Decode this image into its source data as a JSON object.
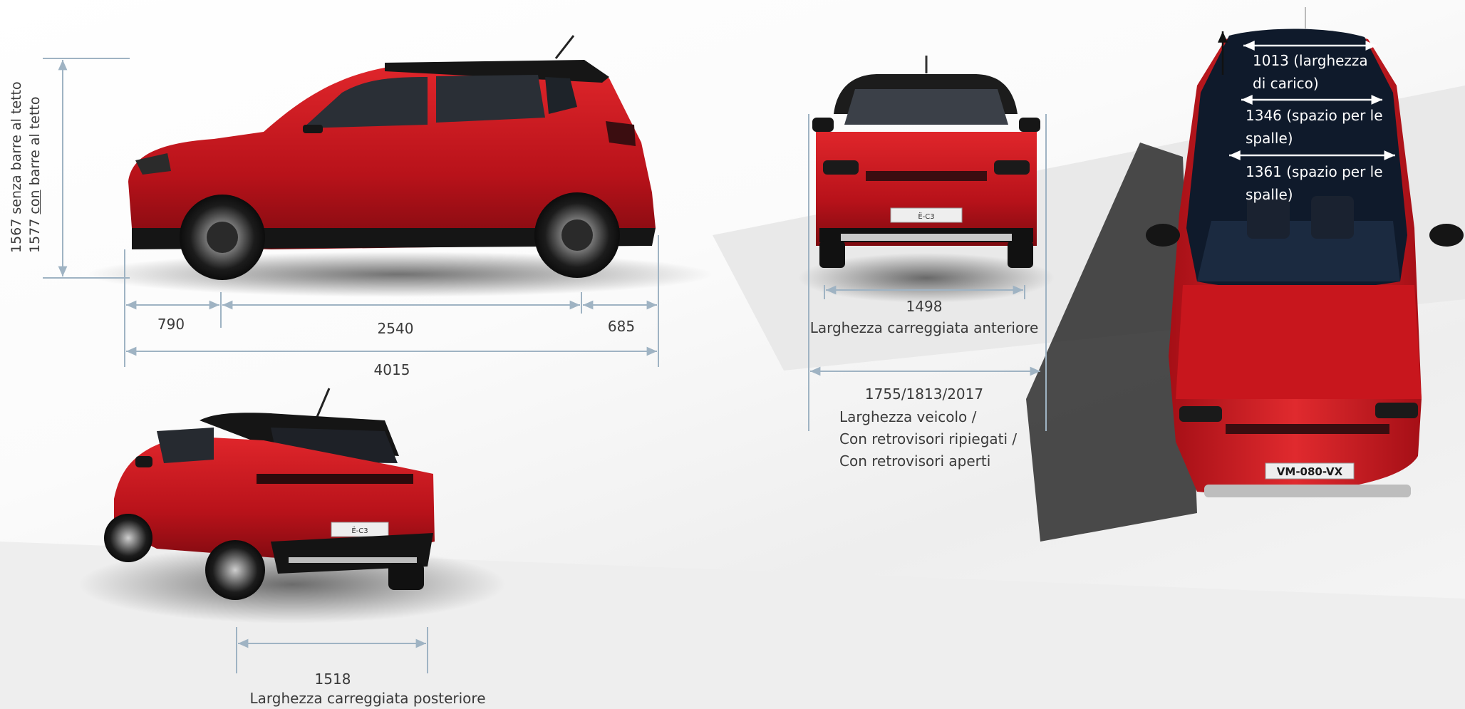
{
  "side_view": {
    "height_no_bars": "1567 senza barre al tetto",
    "height_with_bars_prefix": "1577 ",
    "height_with_bars_underlined": "con",
    "height_with_bars_suffix": " barre al tetto",
    "front_overhang": "790",
    "wheelbase": "2540",
    "rear_overhang": "685",
    "length": "4015"
  },
  "front_view": {
    "front_track": "1498",
    "front_track_label": "Larghezza carreggiata anteriore",
    "widths": "1755/1813/2017",
    "width_line1": "Larghezza veicolo  /",
    "width_line2": "Con retrovisori ripiegati  /",
    "width_line3": "Con retrovisori aperti",
    "plate": "Ë-C3"
  },
  "rear_view": {
    "rear_track": "1518",
    "rear_track_label": "Larghezza carreggiata posteriore",
    "plate": "Ë-C3"
  },
  "top_view": {
    "load_width_line1": "1013 (larghezza",
    "load_width_line2": "di carico)",
    "shoulder1_line1": "1346 (spazio per le",
    "shoulder1_line2": "spalle)",
    "shoulder2_line1": "1361 (spazio per le",
    "shoulder2_line2": "spalle)",
    "plate": "VM-080-VX"
  },
  "colors": {
    "body_red": "#c8161d",
    "roof_black": "#1a1a1a",
    "dimension_line": "#9fb3c3"
  }
}
